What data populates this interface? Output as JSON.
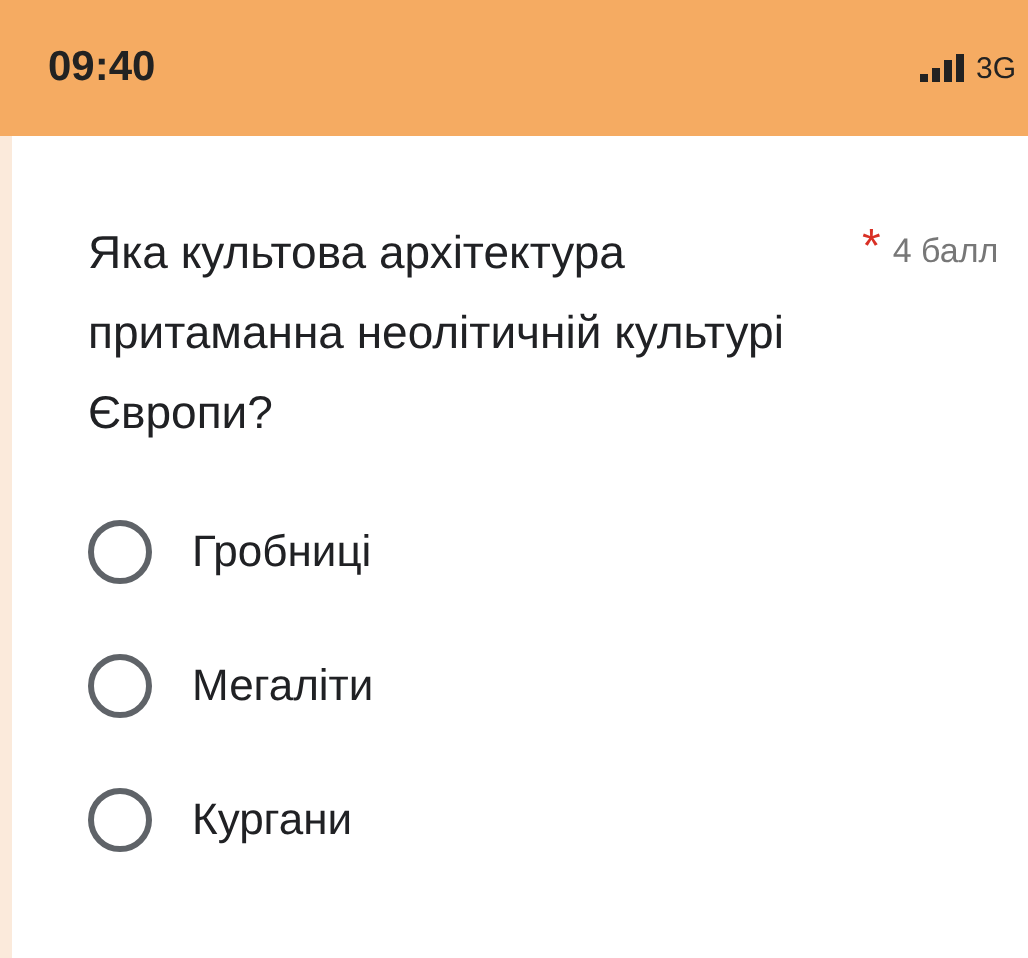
{
  "status_bar": {
    "time": "09:40",
    "network": "3G"
  },
  "question": {
    "text": "Яка культова архітектура притаманна неолітичній культурі Європи?",
    "required_mark": "*",
    "points": "4 балл"
  },
  "options": [
    {
      "label": "Гробниці",
      "selected": false
    },
    {
      "label": "Мегаліти",
      "selected": false
    },
    {
      "label": "Кургани",
      "selected": false
    }
  ]
}
